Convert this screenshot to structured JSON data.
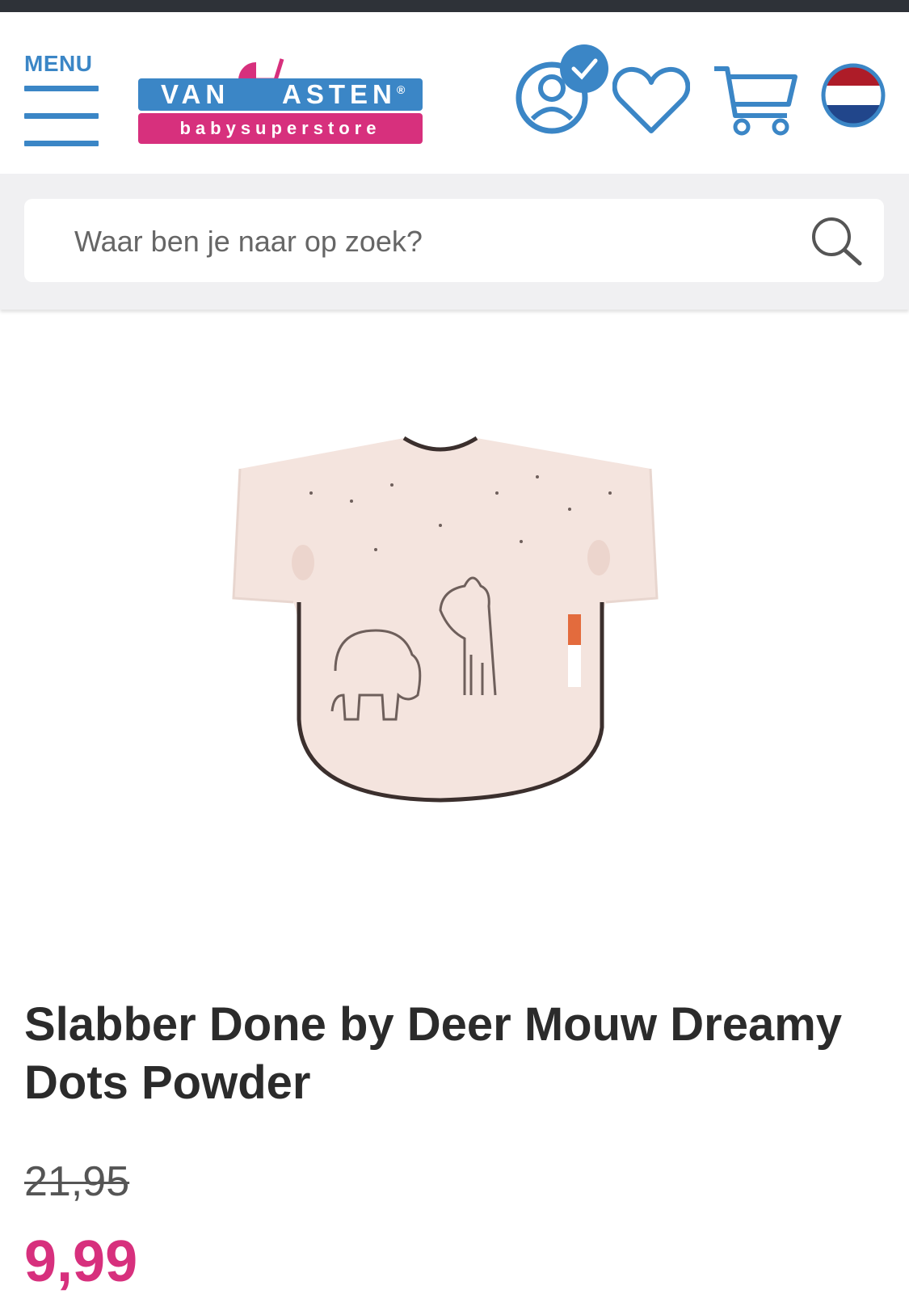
{
  "header": {
    "menu_label": "MENU",
    "logo": {
      "top_left": "VAN",
      "top_right": "ASTEN",
      "registered": "®",
      "bottom": "babysuperstore"
    },
    "icons": [
      "account-icon",
      "heart-icon",
      "cart-icon",
      "flag-nl-icon"
    ]
  },
  "search": {
    "placeholder": "Waar ben je naar op zoek?"
  },
  "product": {
    "title": "Slabber Done by Deer Mouw Dreamy Dots Powder",
    "old_price": "21,95",
    "price": "9,99"
  },
  "colors": {
    "brand_blue": "#3b86c6",
    "brand_pink": "#d7307d",
    "topbar": "#2e3238",
    "bib": "#f4e4de"
  }
}
